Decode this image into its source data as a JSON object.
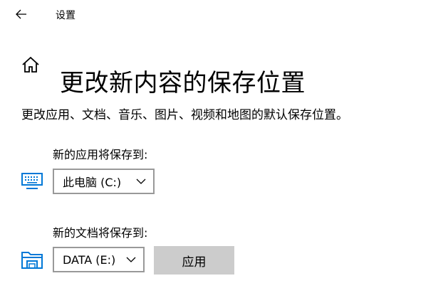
{
  "window": {
    "title": "设置"
  },
  "header": {
    "title": "更改新内容的保存位置"
  },
  "description": "更改应用、文档、音乐、图片、视频和地图的默认保存位置。",
  "sections": [
    {
      "label": "新的应用将保存到:",
      "selected": "此电脑 (C:)",
      "icon": "monitor-icon"
    },
    {
      "label": "新的文档将保存到:",
      "selected": "DATA (E:)",
      "icon": "folder-icon",
      "apply_label": "应用"
    }
  ],
  "colors": {
    "accent": "#0078d7",
    "button_bg": "#cccccc",
    "dropdown_border": "#999999"
  }
}
